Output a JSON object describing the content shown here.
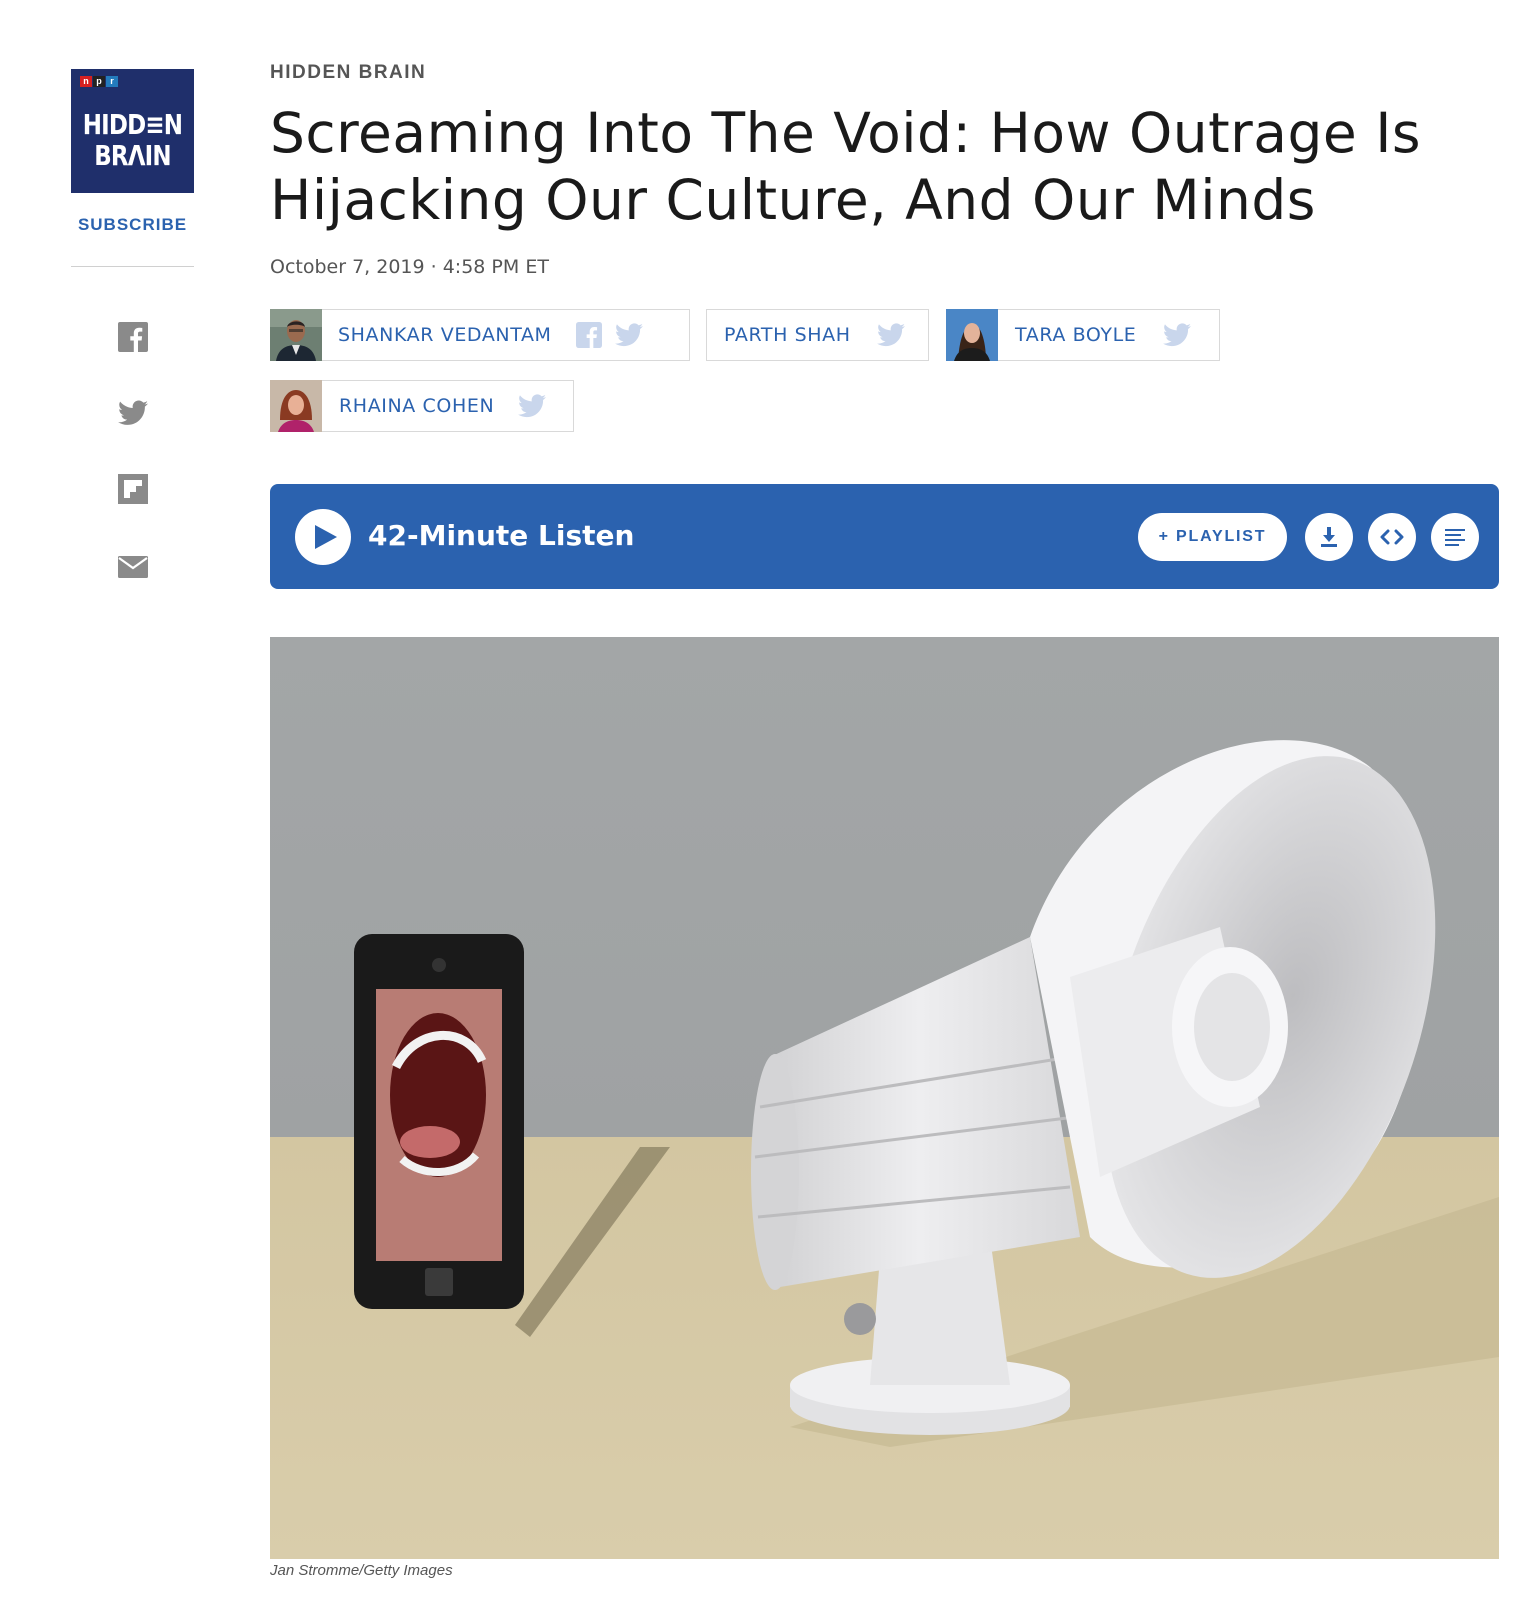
{
  "logo": {
    "npr_letters": [
      "n",
      "p",
      "r"
    ],
    "line1": "HIDD≡N",
    "line2": "BRɅIN",
    "bg_color": "#1f2f6b"
  },
  "subscribe_label": "SUBSCRIBE",
  "share_icons": [
    "facebook-icon",
    "twitter-icon",
    "flipboard-icon",
    "email-icon"
  ],
  "article": {
    "kicker": "HIDDEN BRAIN",
    "headline": "Screaming Into The Void: How Outrage Is Hijacking Our Culture, And Our Minds",
    "dateline": "October 7, 2019 · 4:58 PM ET"
  },
  "bylines": [
    {
      "name": "SHANKAR VEDANTAM",
      "has_photo": true,
      "social": [
        "facebook-icon",
        "twitter-icon"
      ]
    },
    {
      "name": "PARTH SHAH",
      "has_photo": false,
      "social": [
        "twitter-icon"
      ]
    },
    {
      "name": "TARA BOYLE",
      "has_photo": true,
      "social": [
        "twitter-icon"
      ]
    },
    {
      "name": "RHAINA COHEN",
      "has_photo": true,
      "social": [
        "twitter-icon"
      ]
    }
  ],
  "player": {
    "listen_label": "42-Minute Listen",
    "playlist_label": "+ PLAYLIST",
    "buttons": [
      "download-icon",
      "embed-icon",
      "transcript-icon"
    ],
    "accent_color": "#2b62af"
  },
  "image": {
    "credit": "Jan Stromme/Getty Images"
  }
}
